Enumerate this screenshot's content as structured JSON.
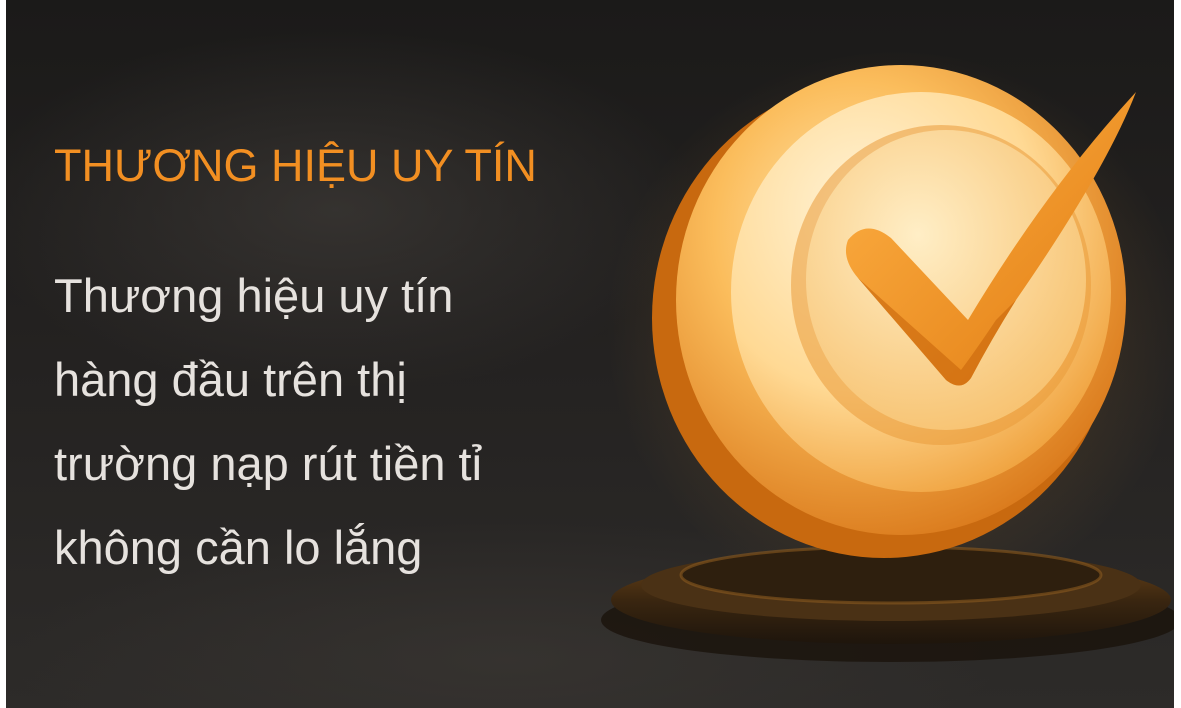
{
  "card": {
    "title": "THƯƠNG HIỆU UY TÍN",
    "description": "Thương hiệu uy tín\nhàng đầu trên thị\ntrường nạp rút tiền tỉ\nkhông cần lo lắng"
  },
  "illustration": {
    "icon": "checkmark-trophy-icon"
  },
  "colors": {
    "title": "#f28f22",
    "text": "#e6e2de",
    "background": "#1f1d1c",
    "accent": "#f5a030"
  }
}
